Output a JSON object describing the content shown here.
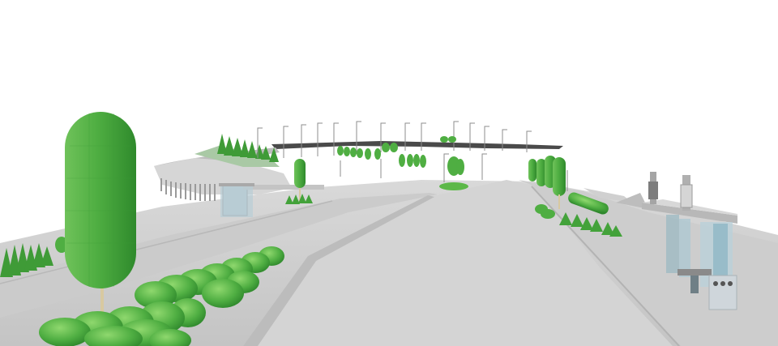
{
  "scene": {
    "kind": "3d-render-street-landscape",
    "colors": {
      "sky": "#ffffff",
      "ground": "#c9c9c9",
      "road": "#d2d2d2",
      "curb": "#b8b8b8",
      "foliage": "#52b043",
      "foliage_dark": "#2f8f2c",
      "foliage_light": "#7ccf5f",
      "trunk": "#d8c9a0",
      "glass": "#a9c7d3",
      "structure": "#9a9a9a",
      "bin": "#cfd6db"
    },
    "icons": [
      "columnar-tree-icon",
      "hedge-icon",
      "conifer-icon",
      "street-lamp-icon",
      "bus-shelter-icon",
      "waste-bin-icon"
    ]
  }
}
